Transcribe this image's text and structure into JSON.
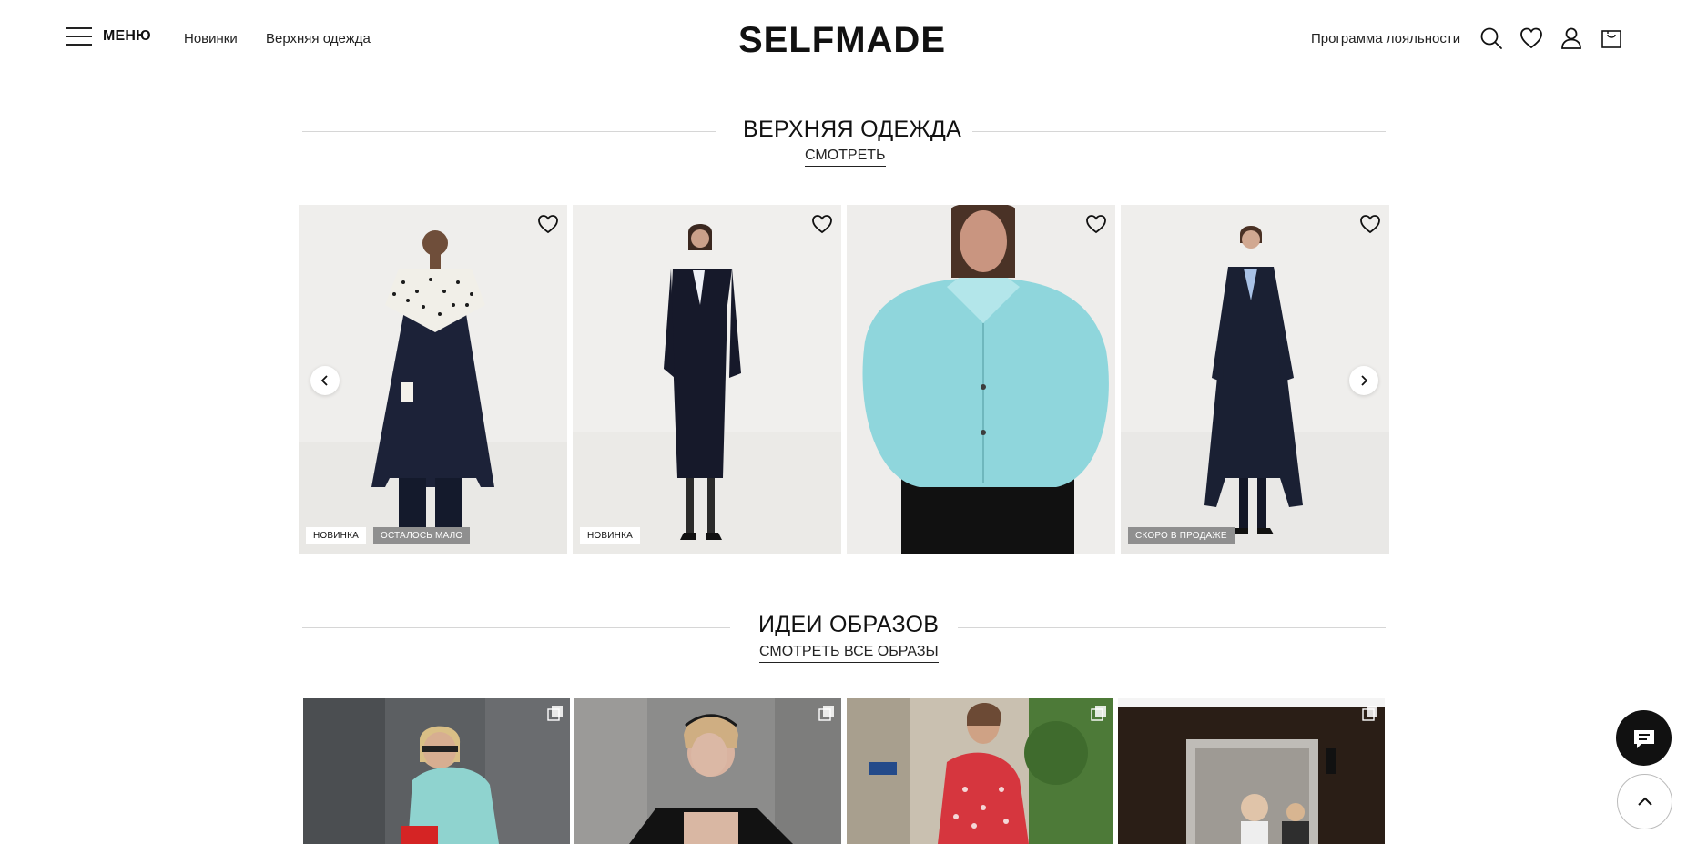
{
  "header": {
    "menu_label": "МЕНЮ",
    "nav": [
      "Новинки",
      "Верхняя одежда"
    ],
    "logo": "SELFMADE",
    "loyalty": "Программа лояльности",
    "icons": [
      "search-icon",
      "heart-icon",
      "user-icon",
      "cart-icon"
    ]
  },
  "outerwear": {
    "title": "ВЕРХНЯЯ ОДЕЖДА",
    "link": "СМОТРЕТЬ",
    "products": [
      {
        "badges": [
          "НОВИНКА",
          "ОСТАЛОСЬ МАЛО"
        ]
      },
      {
        "badges": [
          "НОВИНКА"
        ]
      },
      {
        "badges": []
      },
      {
        "badges": [
          "СКОРО В ПРОДАЖЕ"
        ]
      }
    ]
  },
  "looks": {
    "title": "ИДЕИ ОБРАЗОВ",
    "link": "СМОТРЕТЬ ВСЕ ОБРАЗЫ"
  },
  "colors": {
    "accent": "#111111",
    "badge_grey": "#8f8f8f",
    "divider": "#d6d6d6"
  }
}
